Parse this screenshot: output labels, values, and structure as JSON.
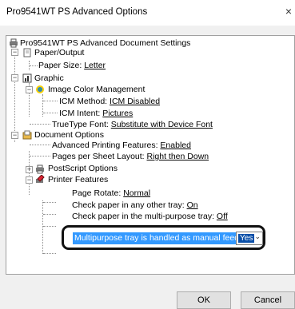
{
  "window": {
    "title": "Pro9541WT PS Advanced Options",
    "close_glyph": "×"
  },
  "tree": {
    "root": "Pro9541WT PS Advanced Document Settings",
    "paper_output": "Paper/Output",
    "paper_size_label": "Paper Size: ",
    "paper_size_value": "Letter",
    "graphic": "Graphic",
    "icm": "Image Color Management",
    "icm_method_label": "ICM Method: ",
    "icm_method_value": "ICM Disabled",
    "icm_intent_label": "ICM Intent: ",
    "icm_intent_value": "Pictures",
    "truetype_label": "TrueType Font: ",
    "truetype_value": "Substitute with Device Font",
    "document_options": "Document Options",
    "adv_printing_label": "Advanced Printing Features: ",
    "adv_printing_value": "Enabled",
    "pages_per_sheet_label": "Pages per Sheet Layout: ",
    "pages_per_sheet_value": "Right then Down",
    "postscript_options": "PostScript Options",
    "printer_features": "Printer Features",
    "page_rotate_label": "Page Rotate: ",
    "page_rotate_value": "Normal",
    "check_other_label": "Check paper in any other tray: ",
    "check_other_value": "On",
    "check_mp_label": "Check paper in the multi-purpose tray: ",
    "check_mp_value": "Off",
    "mp_manual_label": "Multipurpose tray is handled as manual feed:",
    "mp_manual_value": "Yes",
    "mp_options": [
      "Yes"
    ]
  },
  "buttons": {
    "ok": "OK",
    "cancel": "Cancel"
  },
  "icons": [
    "printer-icon",
    "paper-icon",
    "graphic-icon",
    "color-management-icon",
    "document-icon",
    "printer-features-icon",
    "chevron-down-icon"
  ]
}
